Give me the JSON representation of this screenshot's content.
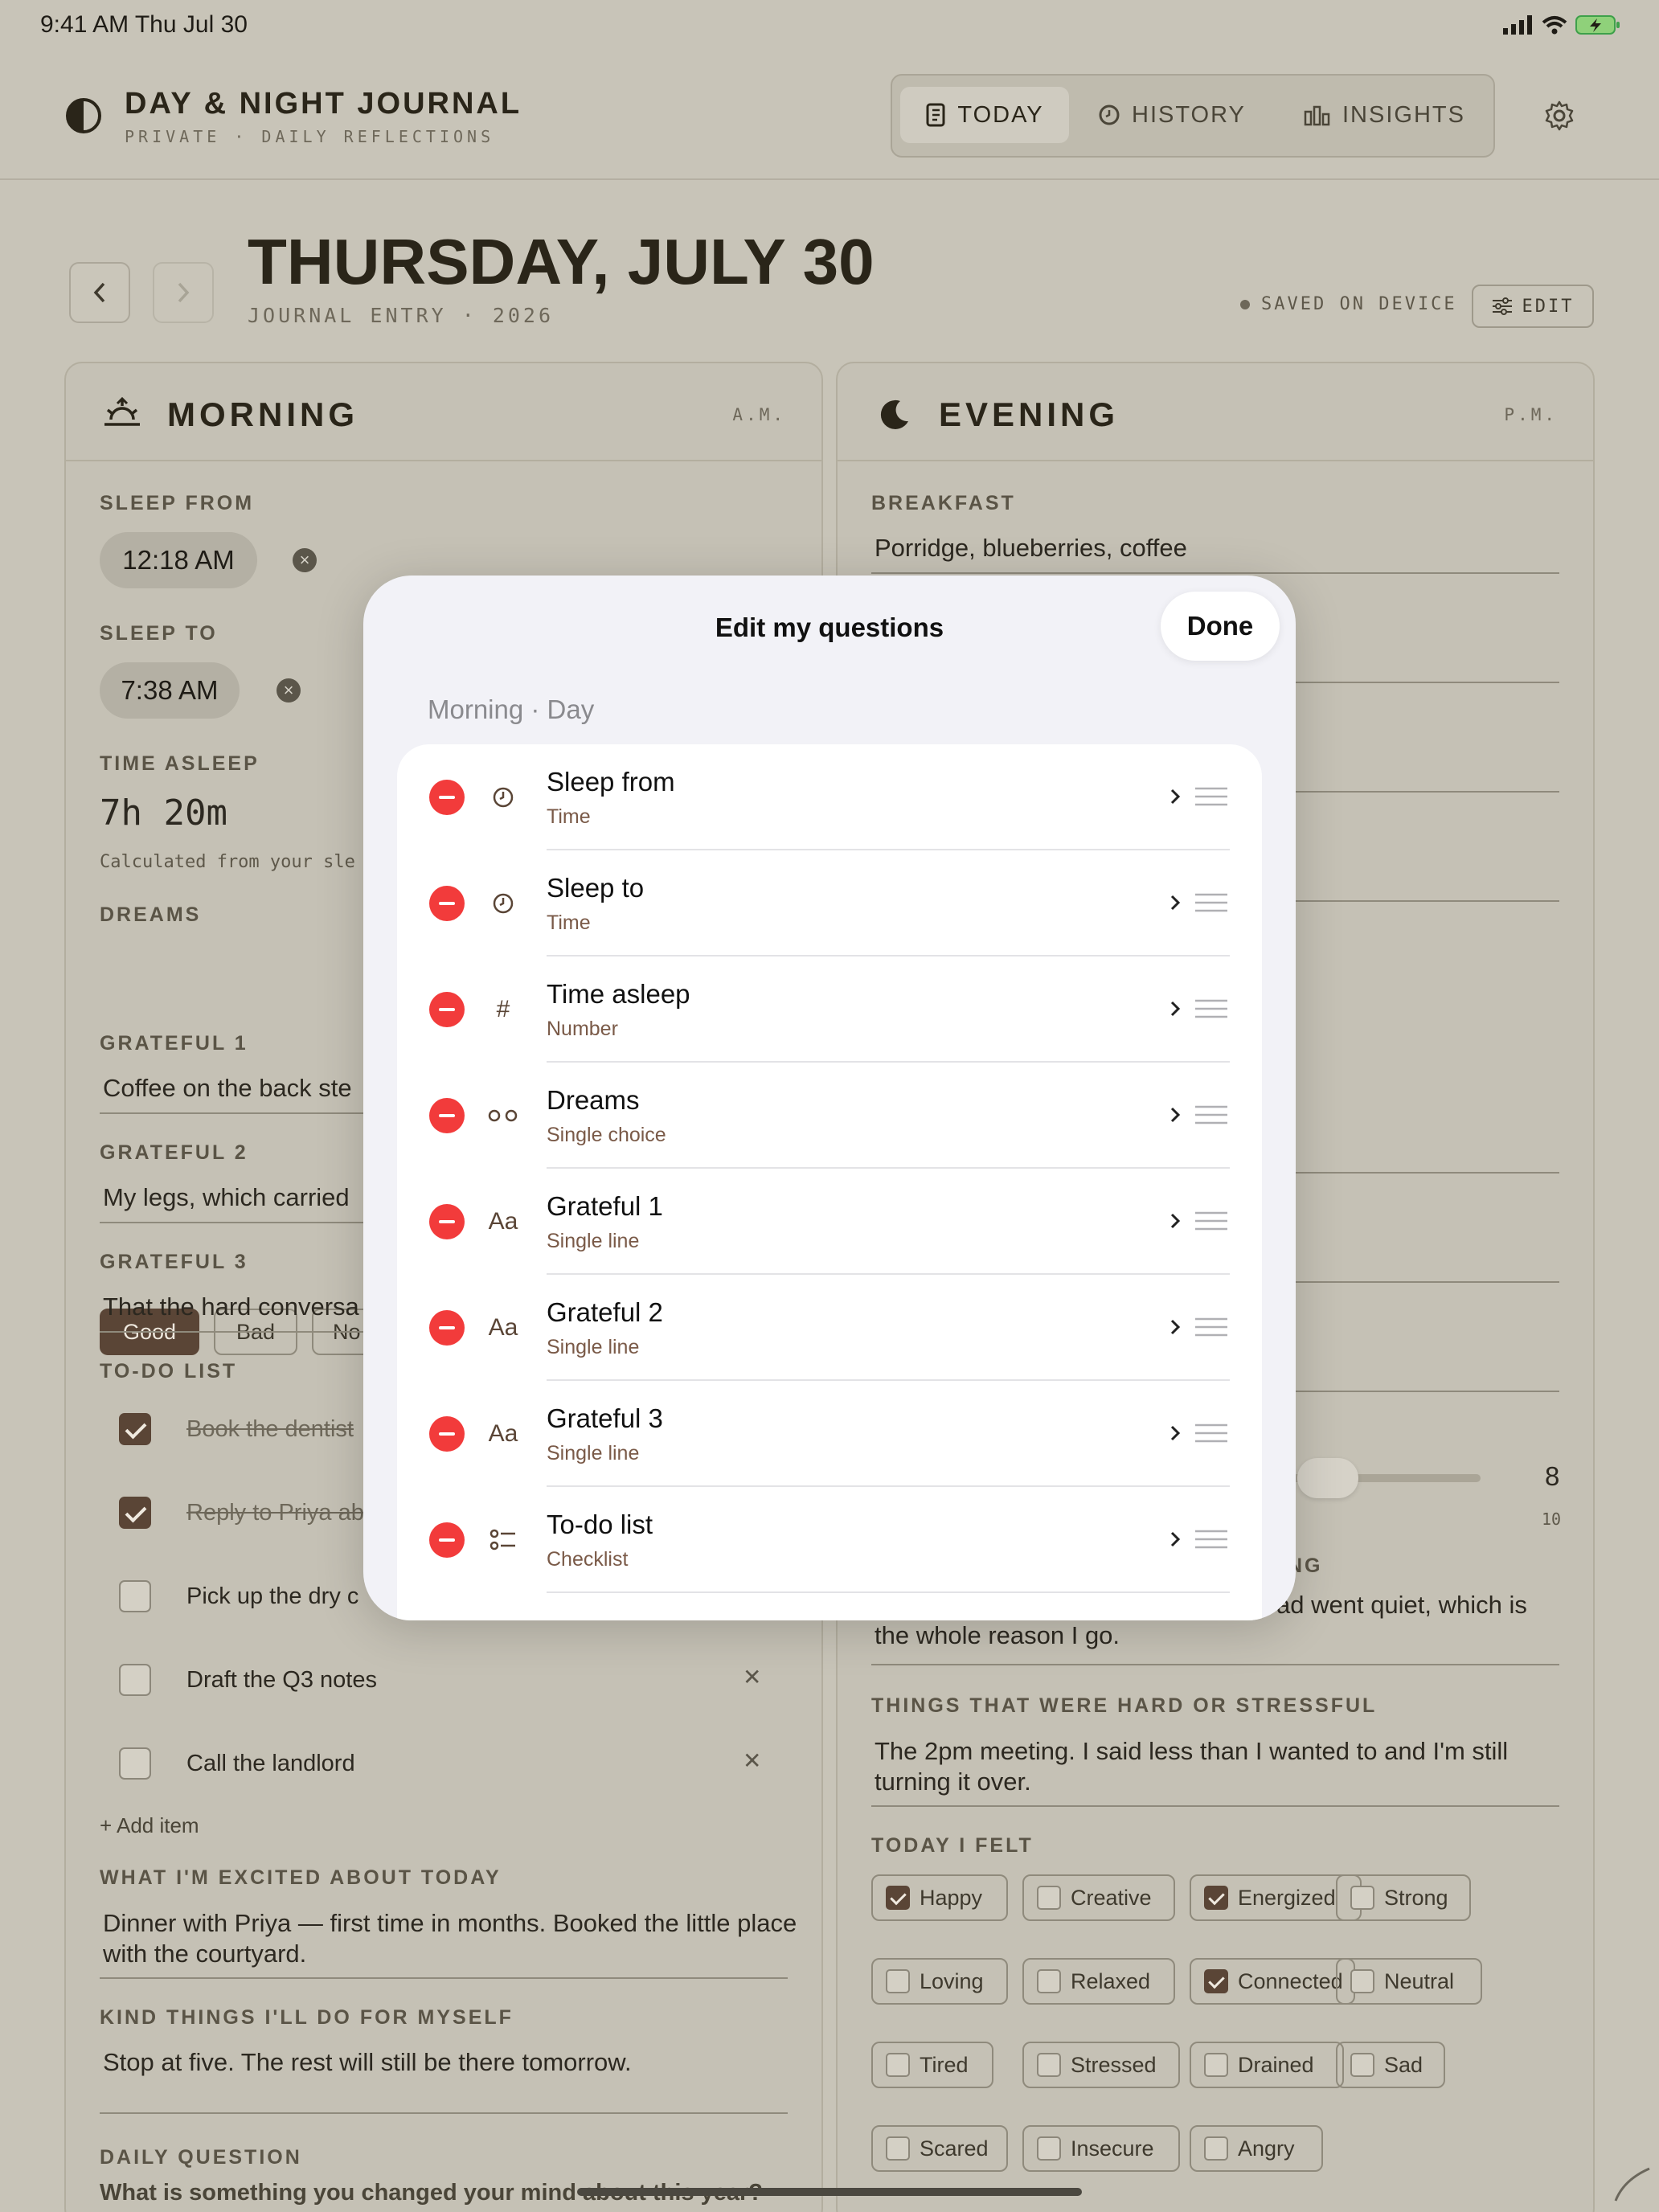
{
  "status_bar": {
    "time": "9:41 AM   Thu Jul 30"
  },
  "app": {
    "title": "DAY & NIGHT JOURNAL",
    "subtitle": "PRIVATE · DAILY REFLECTIONS"
  },
  "nav": {
    "tabs": [
      {
        "label": "TODAY",
        "icon": "journal-icon",
        "active": true
      },
      {
        "label": "HISTORY",
        "icon": "clock-icon",
        "active": false
      },
      {
        "label": "INSIGHTS",
        "icon": "bar-chart-icon",
        "active": false
      }
    ],
    "settings_icon": "gear-icon"
  },
  "date": {
    "title": "THURSDAY, JULY 30",
    "subtitle": "JOURNAL ENTRY · 2026",
    "saved": "SAVED ON DEVICE",
    "edit": "EDIT"
  },
  "morning": {
    "title": "MORNING",
    "period": "A.M.",
    "sleep_from": {
      "label": "SLEEP FROM",
      "value": "12:18 AM"
    },
    "sleep_to": {
      "label": "SLEEP TO",
      "value": "7:38 AM"
    },
    "time_asleep": {
      "label": "TIME ASLEEP",
      "value": "7h 20m",
      "note": "Calculated from your sle"
    },
    "dreams": {
      "label": "DREAMS",
      "options": [
        "Good",
        "Bad",
        "No"
      ],
      "selected": "Good"
    },
    "grateful": [
      {
        "label": "GRATEFUL 1",
        "value": "Coffee on the back ste"
      },
      {
        "label": "GRATEFUL 2",
        "value": "My legs, which carried"
      },
      {
        "label": "GRATEFUL 3",
        "value": "That the hard conversa"
      }
    ],
    "todo": {
      "label": "TO-DO LIST",
      "items": [
        {
          "text": "Book the dentist",
          "done": true
        },
        {
          "text": "Reply to Priya ab",
          "done": true
        },
        {
          "text": "Pick up the dry c",
          "done": false
        },
        {
          "text": "Draft the Q3 notes",
          "done": false
        },
        {
          "text": "Call the landlord",
          "done": false
        }
      ],
      "add": "+ Add item"
    },
    "excited": {
      "label": "WHAT I'M EXCITED ABOUT TODAY",
      "value": "Dinner with Priya — first time in months. Booked the little place with the courtyard."
    },
    "kind": {
      "label": "KIND THINGS I'LL DO FOR MYSELF",
      "value": "Stop at five. The rest will still be there tomorrow."
    },
    "daily": {
      "label": "DAILY QUESTION",
      "value": "What is something you changed your mind about this year?"
    }
  },
  "evening": {
    "title": "EVENING",
    "period": "P.M.",
    "breakfast": {
      "label": "BREAKFAST",
      "value": "Porridge, blueberries, coffee"
    },
    "slider": {
      "value": "8",
      "max": "10",
      "fraction": 0.8
    },
    "partial_label": "NG",
    "partial_value": "ad went quiet, which is the whole reason I go.",
    "hard": {
      "label": "THINGS THAT WERE HARD OR STRESSFUL",
      "value": "The 2pm meeting. I said less than I wanted to and I'm still turning it over."
    },
    "felt": {
      "label": "TODAY I FELT",
      "rows": [
        [
          {
            "t": "Happy",
            "on": true
          },
          {
            "t": "Creative",
            "on": false
          },
          {
            "t": "Energized",
            "on": true
          },
          {
            "t": "Strong",
            "on": false
          }
        ],
        [
          {
            "t": "Loving",
            "on": false
          },
          {
            "t": "Relaxed",
            "on": false
          },
          {
            "t": "Connected",
            "on": true
          },
          {
            "t": "Neutral",
            "on": false
          }
        ],
        [
          {
            "t": "Tired",
            "on": false
          },
          {
            "t": "Stressed",
            "on": false
          },
          {
            "t": "Drained",
            "on": false
          },
          {
            "t": "Sad",
            "on": false
          }
        ],
        [
          {
            "t": "Scared",
            "on": false
          },
          {
            "t": "Insecure",
            "on": false
          },
          {
            "t": "Angry",
            "on": false
          }
        ]
      ]
    }
  },
  "modal": {
    "title": "Edit my questions",
    "done": "Done",
    "section": "Morning · Day",
    "questions": [
      {
        "name": "Sleep from",
        "type": "Time",
        "icon": "clock-icon"
      },
      {
        "name": "Sleep to",
        "type": "Time",
        "icon": "clock-icon"
      },
      {
        "name": "Time asleep",
        "type": "Number",
        "icon": "hash-icon"
      },
      {
        "name": "Dreams",
        "type": "Single choice",
        "icon": "choice-icon"
      },
      {
        "name": "Grateful 1",
        "type": "Single line",
        "icon": "text-icon"
      },
      {
        "name": "Grateful 2",
        "type": "Single line",
        "icon": "text-icon"
      },
      {
        "name": "Grateful 3",
        "type": "Single line",
        "icon": "text-icon"
      },
      {
        "name": "To-do list",
        "type": "Checklist",
        "icon": "checklist-icon"
      }
    ],
    "glyphs": {
      "hash": "#",
      "text": "Aa"
    }
  }
}
